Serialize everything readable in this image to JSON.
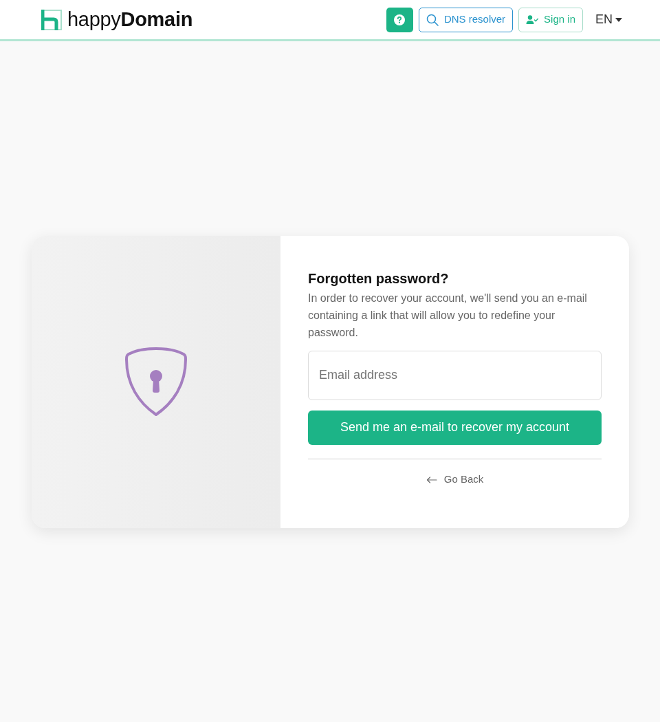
{
  "navbar": {
    "logo_text": "happy**Domain**",
    "buttons": [
      {
        "kind": "help"
      },
      {
        "kind": "search",
        "label": "DNS resolver"
      },
      {
        "kind": "signin",
        "label": "Sign in"
      }
    ],
    "language": "EN"
  },
  "form": {
    "title": "Forgotten password?",
    "description": "In order to recover your account, we'll send you an e-mail containing a link that will allow you to redefine your password.",
    "email_field": {
      "placeholder": "Email address"
    },
    "submit_button": "Send me an e-mail to recover my account",
    "back_link": "Go Back"
  }
}
